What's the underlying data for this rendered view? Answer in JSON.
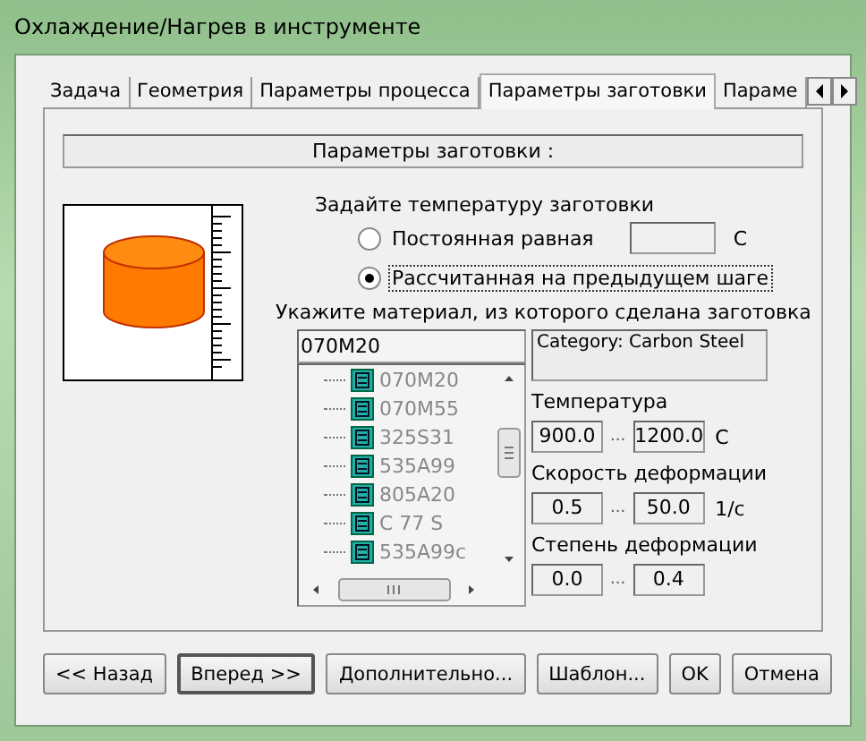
{
  "window": {
    "title": "Охлаждение/Нагрев в инструменте"
  },
  "tabs": [
    {
      "label": "Задача",
      "selected": false
    },
    {
      "label": "Геометрия",
      "selected": false
    },
    {
      "label": "Параметры процесса",
      "selected": false
    },
    {
      "label": "Параметры заготовки",
      "selected": true
    },
    {
      "label": "Параме",
      "selected": false
    }
  ],
  "header": "Параметры заготовки :",
  "temperature": {
    "label": "Задайте температуру заготовки",
    "unit": "C",
    "options": [
      {
        "label": "Постоянная равная",
        "selected": false
      },
      {
        "label": "Рассчитанная на предыдущем шаге",
        "selected": true
      }
    ]
  },
  "material": {
    "label": "Укажите материал, из которого сделана заготовка",
    "value": "070M20",
    "category": "Category:  Carbon Steel",
    "items": [
      "070M20",
      "070M55",
      "325S31",
      "535A99",
      "805A20",
      "C 77 S",
      "535A99c"
    ]
  },
  "ranges": [
    {
      "label": "Температура",
      "min": "900.0",
      "max": "1200.0",
      "unit": "C"
    },
    {
      "label": "Скорость деформации",
      "min": "0.5",
      "max": "50.0",
      "unit": "1/c"
    },
    {
      "label": "Степень деформации",
      "min": "0.0",
      "max": "0.4"
    }
  ],
  "range_separator": "...",
  "buttons": [
    {
      "label": "<< Назад",
      "default": false
    },
    {
      "label": "Вперед >>",
      "default": true
    },
    {
      "label": "Дополнительно...",
      "default": false
    },
    {
      "label": "Шаблон...",
      "default": false
    },
    {
      "label": "OK",
      "default": false
    },
    {
      "label": "Отмена",
      "default": false
    }
  ]
}
